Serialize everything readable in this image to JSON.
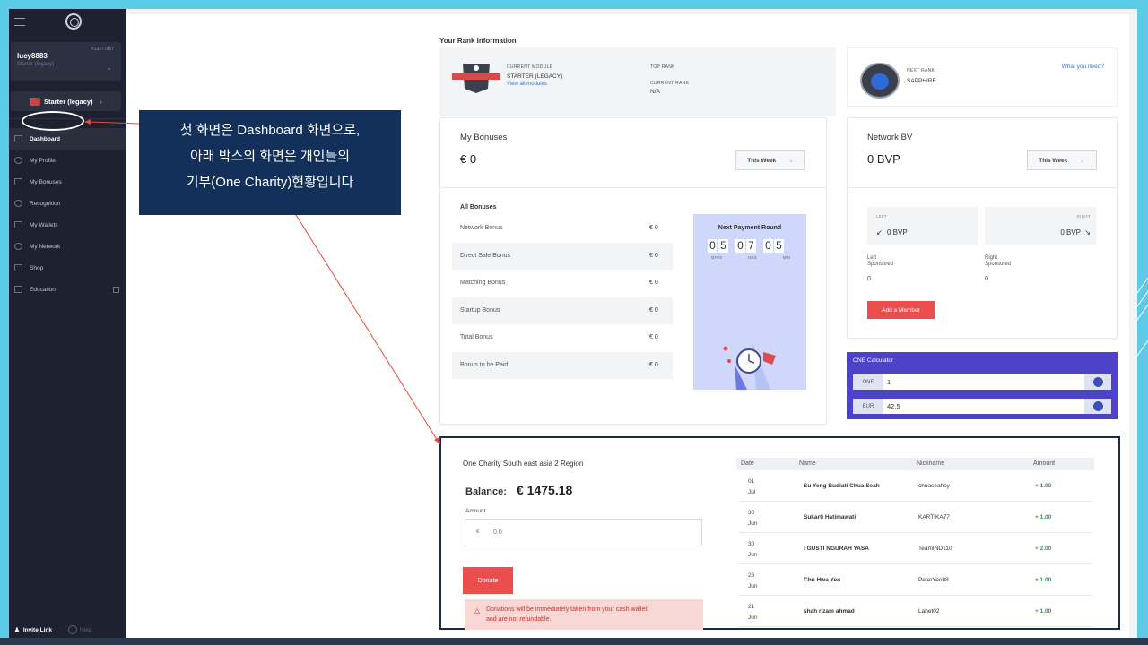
{
  "colors": {
    "accent_red": "#ea4f4e",
    "sidebar_bg": "#1e2230",
    "calc_bg": "#4c43c8",
    "payment_box": "#cfd8fb",
    "positive_green": "#2e9a52",
    "annotation_bg": "#12305a"
  },
  "sidebar": {
    "username": "lucy8883",
    "user_level": "Starter (legacy)",
    "user_id": "#13277857",
    "rank_button": "Starter (legacy)",
    "items": [
      {
        "label": "Dashboard",
        "icon": "home-icon"
      },
      {
        "label": "My Profile",
        "icon": "user-icon"
      },
      {
        "label": "My Bonuses",
        "icon": "wallet-icon"
      },
      {
        "label": "Recognition",
        "icon": "star-icon"
      },
      {
        "label": "My Wallets",
        "icon": "card-icon"
      },
      {
        "label": "My Network",
        "icon": "network-icon"
      },
      {
        "label": "Shop",
        "icon": "cart-icon"
      },
      {
        "label": "Education",
        "icon": "education-icon"
      }
    ],
    "invite": "Invite Link",
    "help": "Help"
  },
  "annotation": {
    "line1": "첫 화면은 Dashboard 화면으로,",
    "line2": "아래 박스의 화면은 개인들의",
    "line3": "기부(One Charity)현황입니다"
  },
  "rank": {
    "section_title": "Your Rank Information",
    "current_module_label": "CURRENT MODULE",
    "current_module": "STARTER (LEGACY)",
    "view_modules": "View all modules",
    "top_rank_label": "TOP RANK",
    "current_rank_label": "CURRENT RANK",
    "current_rank": "N/A",
    "next_rank_label": "NEXT RANK",
    "next_rank": "SAPPHIRE",
    "what_need": "What you need?",
    "badge_text": "SAPPHIRE"
  },
  "bonuses": {
    "title": "My Bonuses",
    "total": "€ 0",
    "period": "This Week",
    "list_title": "All Bonuses",
    "rows": [
      {
        "name": "Network Bonus",
        "amount": "€ 0"
      },
      {
        "name": "Direct Sale Bonus",
        "amount": "€ 0"
      },
      {
        "name": "Matching Bonus",
        "amount": "€ 0"
      },
      {
        "name": "Startup Bonus",
        "amount": "€ 0"
      },
      {
        "name": "Total Bonus",
        "amount": "€ 0"
      },
      {
        "name": "Bonus to be Paid",
        "amount": "€ 0"
      }
    ],
    "payment": {
      "title": "Next Payment Round",
      "days": [
        "0",
        "5"
      ],
      "hrs": [
        "0",
        "7"
      ],
      "min": [
        "0",
        "5"
      ],
      "days_label": "DAYS",
      "hrs_label": "HRS",
      "min_label": "MIN"
    }
  },
  "network": {
    "title": "Network BV",
    "total": "0 BVP",
    "period": "This Week",
    "left_label": "LEFT",
    "left_value": "0 BVP",
    "right_label": "RIGHT",
    "right_value": "0 BVP",
    "left_sponsored_label_1": "Left",
    "left_sponsored_label_2": "Sponsored",
    "left_sponsored_value": "0",
    "right_sponsored_label_1": "Right",
    "right_sponsored_label_2": "Sponsored",
    "right_sponsored_value": "0",
    "add_member": "Add a Member"
  },
  "calculator": {
    "title": "ONE Calculator",
    "one_tag": "ONE",
    "one_value": "1",
    "eur_tag": "EUR",
    "eur_value": "42.5"
  },
  "charity": {
    "title": "One Charity South east asia 2 Region",
    "balance_label": "Balance:",
    "balance": "€ 1475.18",
    "amount_label": "Amount",
    "currency": "€",
    "amount_placeholder": "0.0",
    "donate": "Donate",
    "warning_1": "Donations will be immediately taken from your cash wallet",
    "warning_2": "and are not refundable.",
    "columns": [
      "Date",
      "Name",
      "Nickname",
      "Amount"
    ],
    "rows": [
      {
        "day": "01",
        "month": "Jul",
        "name": "Su Yeng Budiati Chua Seah",
        "nickname": "chuaseahsy",
        "amount": "+ 1.00"
      },
      {
        "day": "30",
        "month": "Jun",
        "name": "Sukarti Hatimawati",
        "nickname": "KARTIKA77",
        "amount": "+ 1.00"
      },
      {
        "day": "30",
        "month": "Jun",
        "name": "I GUSTI NGURAH YASA",
        "nickname": "TeamIND110",
        "amount": "+ 2.00"
      },
      {
        "day": "26",
        "month": "Jun",
        "name": "Cho Hwa Yeo",
        "nickname": "PeterYeo88",
        "amount": "+ 1.00"
      },
      {
        "day": "21",
        "month": "Jun",
        "name": "shah rizam ahmad",
        "nickname": "Lahet02",
        "amount": "+ 1.00"
      }
    ]
  }
}
